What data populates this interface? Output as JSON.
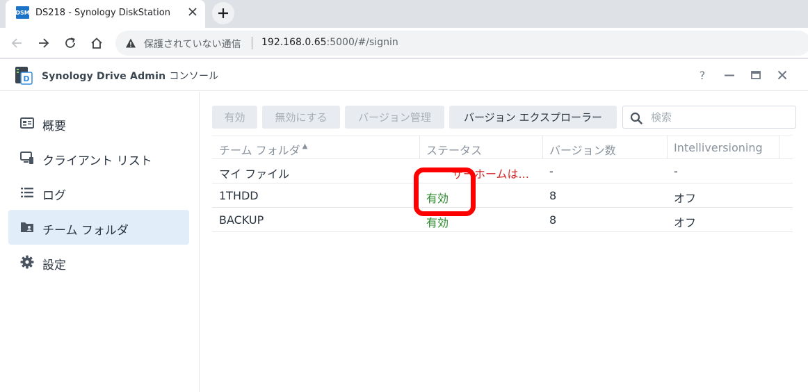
{
  "browser": {
    "tab": {
      "favicon_text": "DSM",
      "title": "DS218 - Synology DiskStation"
    },
    "address_bar": {
      "security_label": "保護されていない通信",
      "url_host": "192.168.0.65",
      "url_path": ":5000/#/signin"
    }
  },
  "app": {
    "title": "Synology Drive Admin",
    "title_suffix": "コンソール",
    "window_controls": {
      "help": "?"
    }
  },
  "sidebar": {
    "items": [
      {
        "label": "概要",
        "icon": "overview-icon"
      },
      {
        "label": "クライアント リスト",
        "icon": "client-list-icon"
      },
      {
        "label": "ログ",
        "icon": "log-list-icon"
      },
      {
        "label": "チーム フォルダ",
        "icon": "team-folder-icon",
        "active": true
      },
      {
        "label": "設定",
        "icon": "gear-icon"
      }
    ]
  },
  "toolbar": {
    "enable": "有効",
    "disable": "無効にする",
    "version_manage": "バージョン管理",
    "version_explorer": "バージョン エクスプローラー",
    "search_placeholder": "検索"
  },
  "table": {
    "columns": [
      "チーム フォルダ",
      "ステータス",
      "バージョン数",
      "Intelliversioning"
    ],
    "rows": [
      {
        "folder": "マイ ファイル",
        "status": "ザーホームは...",
        "versions": "-",
        "intelliversioning": "-"
      },
      {
        "folder": "1THDD",
        "status": "有効",
        "versions": "8",
        "intelliversioning": "オフ"
      },
      {
        "folder": "BACKUP",
        "status": "有効",
        "versions": "8",
        "intelliversioning": "オフ"
      }
    ]
  },
  "colors": {
    "accent": "#1a73c8",
    "status_enabled": "#2e8b2e",
    "status_warning": "#d22626",
    "annotation": "#ff0000",
    "sidebar_active": "#e1eefa"
  }
}
